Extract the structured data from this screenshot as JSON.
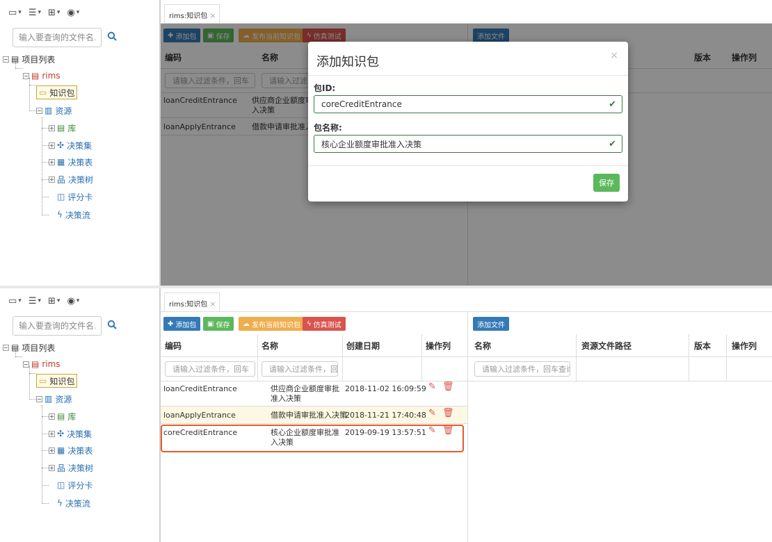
{
  "toolbar_icons": [
    "display-icon",
    "list-icon",
    "grid-icon",
    "globe-icon"
  ],
  "search": {
    "placeholder": "输入要查询的文件名..."
  },
  "tree": {
    "root": "项目列表",
    "project": "rims",
    "knowledge": "知识包",
    "resources": "资源",
    "children": [
      "库",
      "决策集",
      "决策表",
      "决策树",
      "评分卡",
      "决策流"
    ]
  },
  "tab": {
    "label": "rims:知识包",
    "close": "×"
  },
  "buttons": {
    "add_pkg": "添加包",
    "save": "保存",
    "publish": "发布当前知识包",
    "simulate": "仿真测试",
    "add_file": "添加文件"
  },
  "left_table": {
    "headers": [
      "编码",
      "名称",
      "创建日期",
      "操作列"
    ],
    "filter_placeholders": [
      "请输入过滤条件，回车",
      "请输入过滤条件，回"
    ],
    "rows": [
      {
        "code": "loanCreditEntrance",
        "name": "供应商企业额度审批准入决策",
        "date": "2018-11-02 16:09:59"
      },
      {
        "code": "loanApplyEntrance",
        "name": "借款申请审批准入决策",
        "date": "2018-11-21 17:40:48"
      },
      {
        "code": "coreCreditEntrance",
        "name": "核心企业额度审批准入决策",
        "date": "2019-09-19 13:57:51"
      }
    ]
  },
  "right_table": {
    "headers": [
      "名称",
      "资源文件路径",
      "版本",
      "操作列"
    ],
    "filter_placeholder": "请输入过滤条件，回车查询"
  },
  "modal": {
    "title": "添加知识包",
    "close": "×",
    "id_label": "包ID:",
    "id_value": "coreCreditEntrance",
    "name_label": "包名称:",
    "name_value": "核心企业额度审批准入决策",
    "save": "保存"
  },
  "colors": {
    "primary": "#337ab7",
    "success": "#5cb85c",
    "warning": "#f0ad4e",
    "danger": "#d9534f",
    "highlight": "#e25b2c"
  }
}
